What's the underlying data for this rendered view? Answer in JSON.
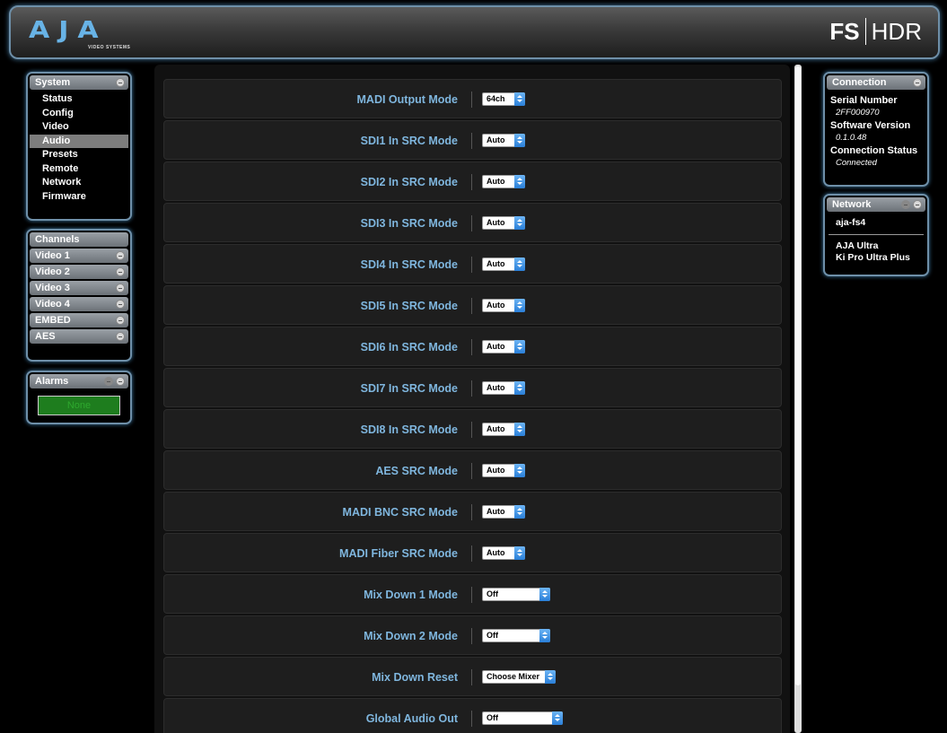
{
  "header": {
    "logo_text": "AJA",
    "logo_subtext": "VIDEO SYSTEMS",
    "product_bold": "FS",
    "product_light": "HDR"
  },
  "system_panel": {
    "title": "System",
    "items": [
      {
        "label": "Status"
      },
      {
        "label": "Config"
      },
      {
        "label": "Video"
      },
      {
        "label": "Audio",
        "active": true
      },
      {
        "label": "Presets"
      },
      {
        "label": "Remote"
      },
      {
        "label": "Network"
      },
      {
        "label": "Firmware"
      }
    ]
  },
  "channels_panel": {
    "title": "Channels",
    "items": [
      {
        "label": "Video 1"
      },
      {
        "label": "Video 2"
      },
      {
        "label": "Video 3"
      },
      {
        "label": "Video 4"
      },
      {
        "label": "EMBED"
      },
      {
        "label": "AES"
      }
    ]
  },
  "alarms_panel": {
    "title": "Alarms",
    "status": "None"
  },
  "connection_panel": {
    "title": "Connection",
    "serial_label": "Serial Number",
    "serial_value": "2FF000970",
    "software_label": "Software Version",
    "software_value": "0.1.0.48",
    "status_label": "Connection Status",
    "status_value": "Connected"
  },
  "network_panel": {
    "title": "Network",
    "current": "aja-fs4",
    "devices": [
      "AJA Ultra",
      "Ki Pro Ultra Plus"
    ]
  },
  "settings": [
    {
      "label": "MADI Output Mode",
      "value": "64ch"
    },
    {
      "label": "SDI1 In SRC Mode",
      "value": "Auto"
    },
    {
      "label": "SDI2 In SRC Mode",
      "value": "Auto"
    },
    {
      "label": "SDI3 In SRC Mode",
      "value": "Auto"
    },
    {
      "label": "SDI4 In SRC Mode",
      "value": "Auto"
    },
    {
      "label": "SDI5 In SRC Mode",
      "value": "Auto"
    },
    {
      "label": "SDI6 In SRC Mode",
      "value": "Auto"
    },
    {
      "label": "SDI7 In SRC Mode",
      "value": "Auto"
    },
    {
      "label": "SDI8 In SRC Mode",
      "value": "Auto"
    },
    {
      "label": "AES SRC Mode",
      "value": "Auto"
    },
    {
      "label": "MADI BNC SRC Mode",
      "value": "Auto"
    },
    {
      "label": "MADI Fiber SRC Mode",
      "value": "Auto"
    },
    {
      "label": "Mix Down 1 Mode",
      "value": "Off"
    },
    {
      "label": "Mix Down 2 Mode",
      "value": "Off"
    },
    {
      "label": "Mix Down Reset",
      "value": "Choose Mixer"
    },
    {
      "label": "Global Audio Out",
      "value": "Off"
    }
  ]
}
